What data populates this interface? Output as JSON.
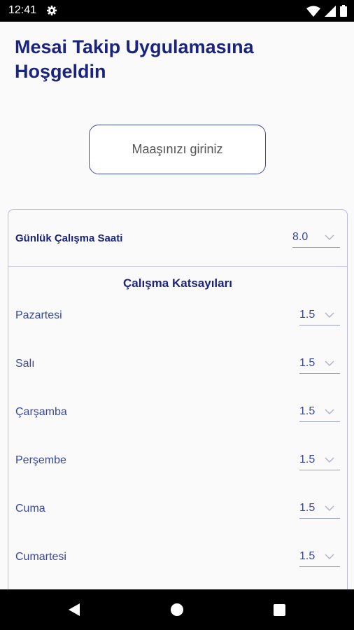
{
  "status": {
    "time": "12:41"
  },
  "title": "Mesai Takip Uygulamasına Hoşgeldin",
  "salary_button": "Maaşınızı giriniz",
  "hours": {
    "label": "Günlük Çalışma Saati",
    "value": "8.0"
  },
  "coefficients": {
    "title": "Çalışma Katsayıları",
    "days": [
      {
        "label": "Pazartesi",
        "value": "1.5"
      },
      {
        "label": "Salı",
        "value": "1.5"
      },
      {
        "label": "Çarşamba",
        "value": "1.5"
      },
      {
        "label": "Perşembe",
        "value": "1.5"
      },
      {
        "label": "Cuma",
        "value": "1.5"
      },
      {
        "label": "Cumartesi",
        "value": "1.5"
      }
    ]
  }
}
